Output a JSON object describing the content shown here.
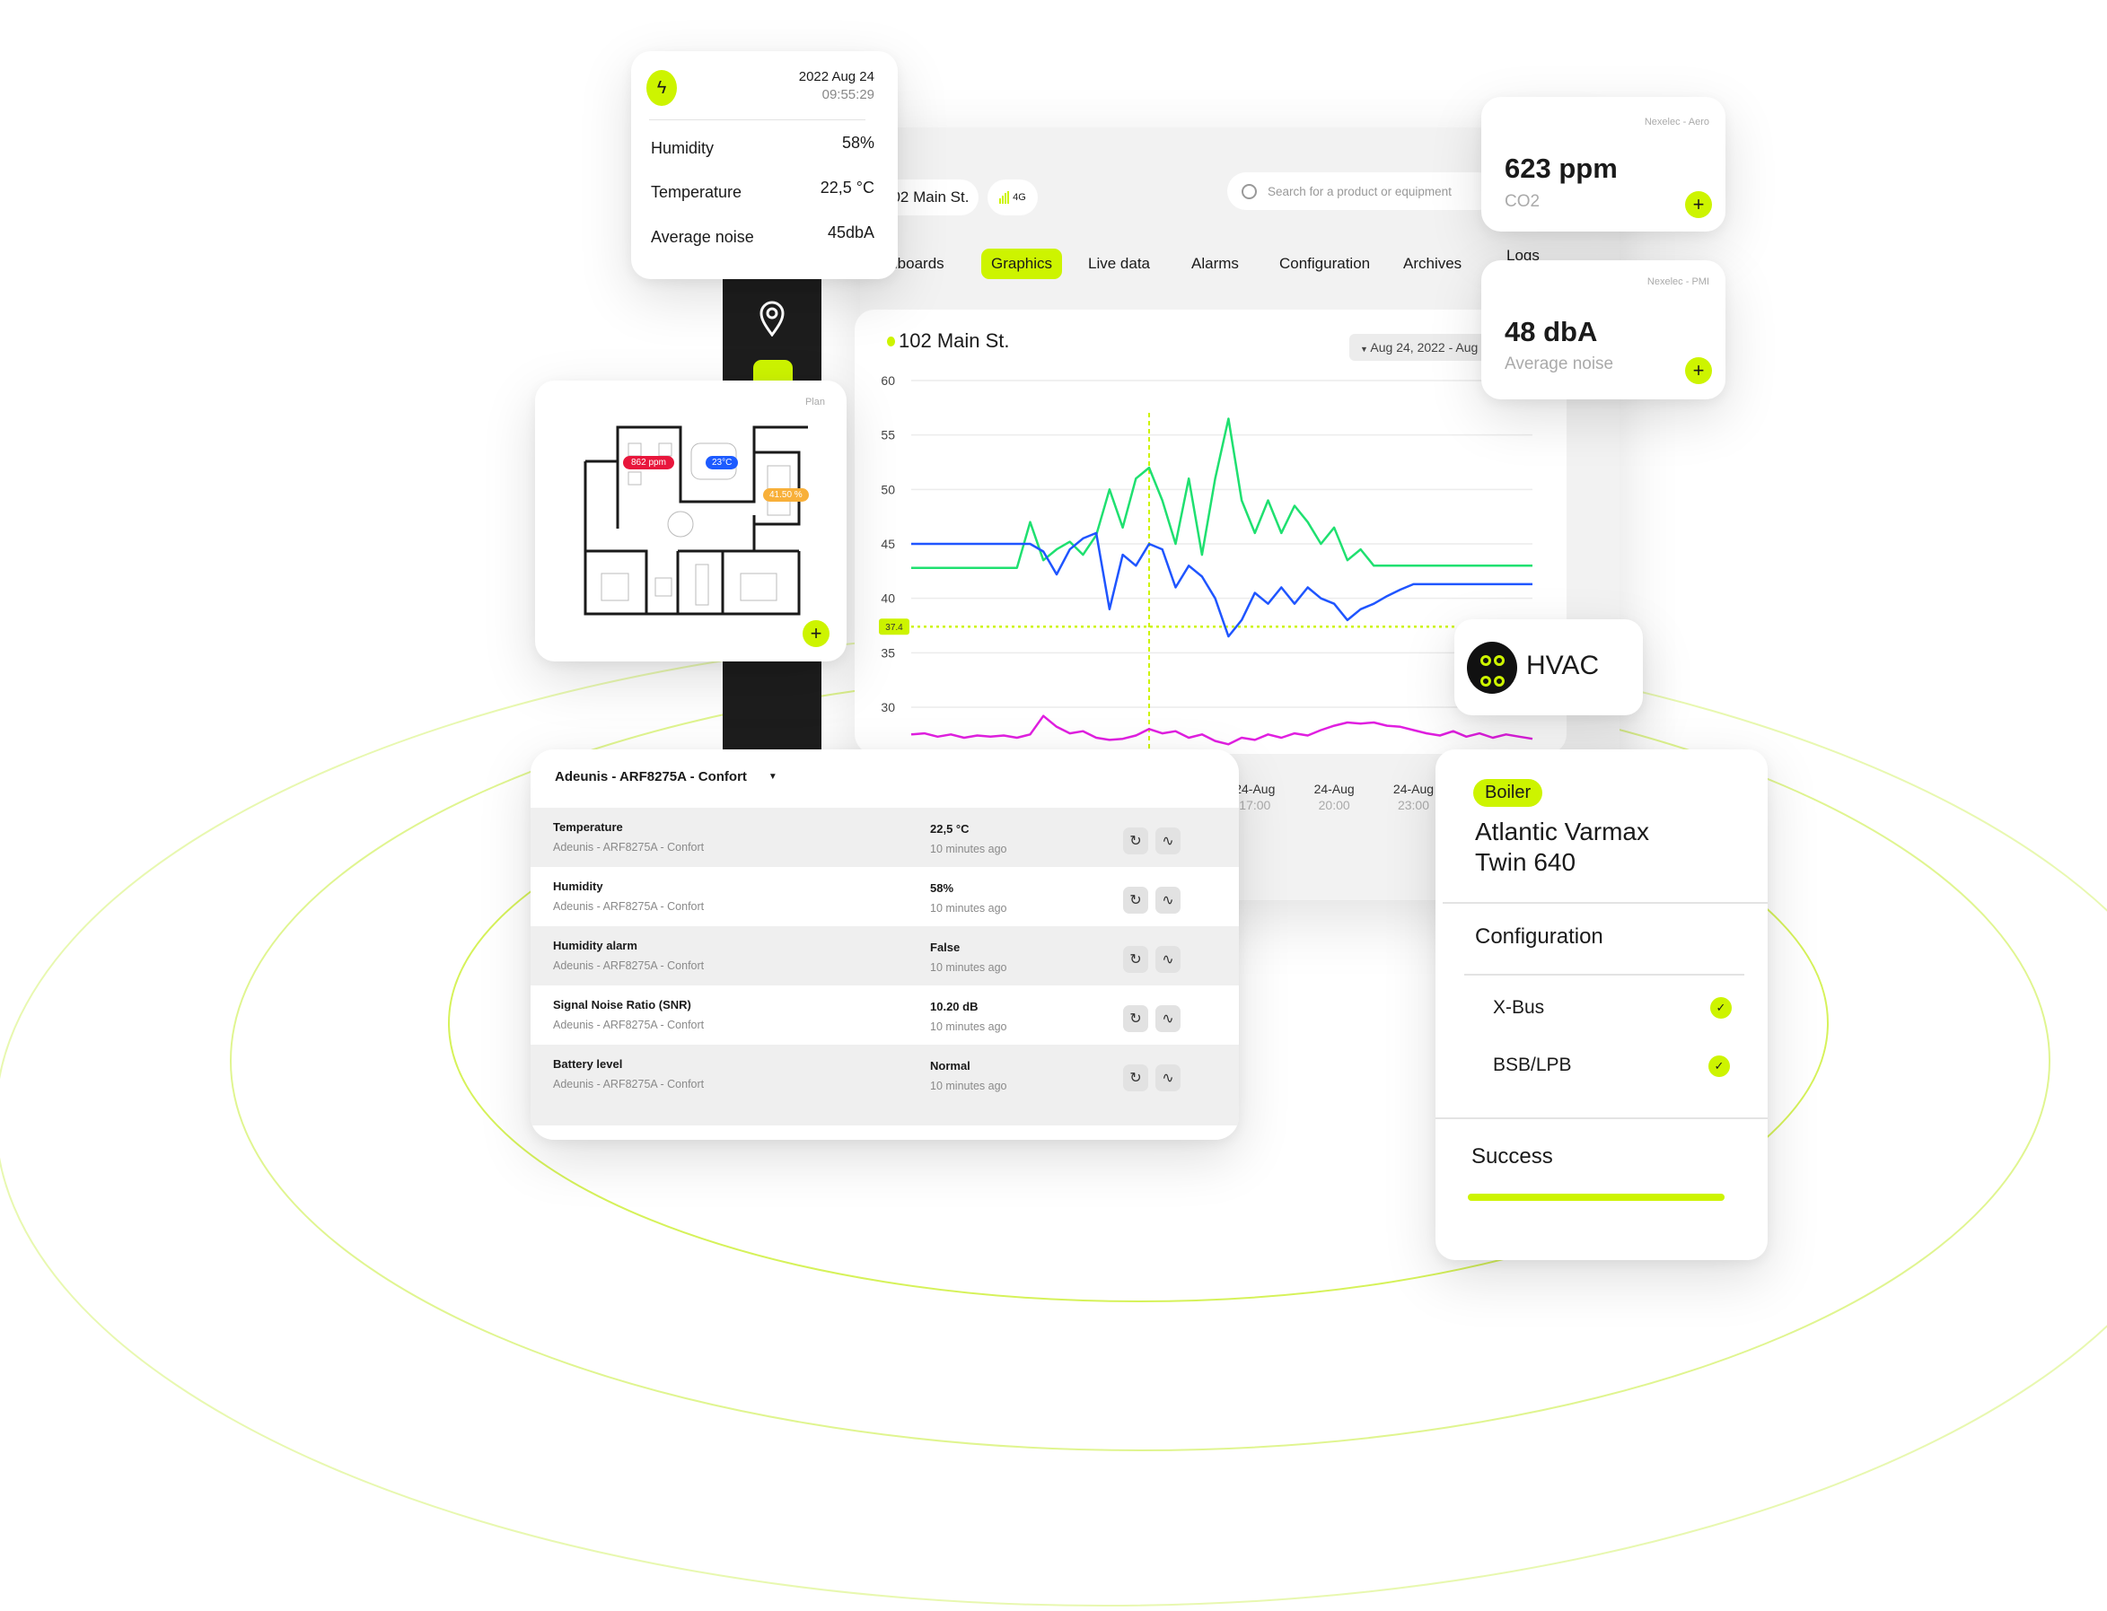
{
  "colors": {
    "accent": "#cdf400",
    "series_green": "#1fe070",
    "series_blue": "#1f55ff",
    "series_purple": "#e01fe0",
    "badge_red": "#e8163c",
    "badge_blue": "#1d5bff",
    "badge_orange": "#f8b03a"
  },
  "sensor_card": {
    "icon": "lightning-icon",
    "date": "2022 Aug 24",
    "time": "09:55:29",
    "rows": [
      {
        "label": "Humidity",
        "value": "58%"
      },
      {
        "label": "Temperature",
        "value": "22,5 °C"
      },
      {
        "label": "Average noise",
        "value": "45dbA"
      }
    ]
  },
  "header": {
    "site": "102 Main St.",
    "network": "4G",
    "search_placeholder": "Search for a product or equipment"
  },
  "tabs": [
    {
      "label": "Dashboards",
      "active": false
    },
    {
      "label": "Graphics",
      "active": true
    },
    {
      "label": "Live data",
      "active": false
    },
    {
      "label": "Alarms",
      "active": false
    },
    {
      "label": "Configuration",
      "active": false
    },
    {
      "label": "Archives",
      "active": false
    },
    {
      "label": "Logs",
      "active": false
    }
  ],
  "sidebar": {
    "items": [
      {
        "icon": "location-pin-icon"
      },
      {
        "icon": "sensor-icon",
        "active": true
      }
    ]
  },
  "chart_header": {
    "title": "102 Main St.",
    "date_range": "Aug 24, 2022 - Aug"
  },
  "chart_data": {
    "type": "line",
    "ylim": [
      30,
      60
    ],
    "yticks": [
      60,
      55,
      50,
      45,
      40,
      35,
      30
    ],
    "grid": true,
    "threshold": {
      "value": 37.4,
      "label": "37.4"
    },
    "cursor_x": "24-Aug 13:00",
    "xtick_labels": [
      {
        "x": "24-Aug 17:00",
        "date": "24-Aug",
        "time": "17:00"
      },
      {
        "x": "24-Aug 20:00",
        "date": "24-Aug",
        "time": "20:00"
      },
      {
        "x": "24-Aug 23:00",
        "date": "24-Aug",
        "time": "23:00"
      }
    ],
    "x": [
      "24-Aug 04:00",
      "24-Aug 04:30",
      "24-Aug 05:00",
      "24-Aug 05:30",
      "24-Aug 06:00",
      "24-Aug 06:30",
      "24-Aug 07:00",
      "24-Aug 07:30",
      "24-Aug 08:00",
      "24-Aug 08:30",
      "24-Aug 09:00",
      "24-Aug 09:30",
      "24-Aug 10:00",
      "24-Aug 10:30",
      "24-Aug 11:00",
      "24-Aug 11:30",
      "24-Aug 12:00",
      "24-Aug 12:30",
      "24-Aug 13:00",
      "24-Aug 13:30",
      "24-Aug 14:00",
      "24-Aug 14:30",
      "24-Aug 15:00",
      "24-Aug 15:30",
      "24-Aug 16:00",
      "24-Aug 16:30",
      "24-Aug 17:00",
      "24-Aug 17:30",
      "24-Aug 18:00",
      "24-Aug 18:30",
      "24-Aug 19:00",
      "24-Aug 19:30",
      "24-Aug 20:00",
      "24-Aug 20:30",
      "24-Aug 21:00",
      "24-Aug 21:30",
      "24-Aug 22:00",
      "24-Aug 22:30",
      "24-Aug 23:00",
      "24-Aug 23:30",
      "25-Aug 00:00",
      "25-Aug 00:30",
      "25-Aug 01:00",
      "25-Aug 01:30",
      "25-Aug 02:00",
      "25-Aug 02:30",
      "25-Aug 03:00",
      "25-Aug 03:30"
    ],
    "series": [
      {
        "color": "#1fe070",
        "values": [
          42.8,
          42.8,
          42.8,
          42.8,
          42.8,
          42.8,
          42.8,
          42.8,
          42.8,
          47,
          43.5,
          44.5,
          45.2,
          44,
          45.8,
          50,
          46.5,
          51,
          52,
          49,
          45,
          51,
          44,
          51,
          56.5,
          49,
          46,
          49,
          46,
          48.5,
          47,
          45,
          46.5,
          43.5,
          44.5,
          43,
          43,
          43,
          43,
          43,
          43,
          43,
          43,
          43,
          43,
          43,
          43,
          43
        ]
      },
      {
        "color": "#1f55ff",
        "values": [
          45,
          45,
          45,
          45,
          45,
          45,
          45,
          45,
          45,
          45,
          44.3,
          42.2,
          44.5,
          45.5,
          46,
          39,
          44,
          43,
          45,
          44.5,
          41,
          43,
          42,
          40,
          36.5,
          38,
          40.5,
          39.5,
          41,
          39.5,
          41,
          40,
          39.5,
          38,
          39,
          39.5,
          40.2,
          40.8,
          41.3,
          41.3,
          41.3,
          41.3,
          41.3,
          41.3,
          41.3,
          41.3,
          41.3,
          41.3
        ]
      },
      {
        "color": "#e01fe0",
        "values": [
          27.5,
          27.6,
          27.3,
          27.5,
          27.2,
          27.4,
          27.3,
          27.4,
          27.2,
          27.5,
          29.2,
          28.2,
          27.6,
          27.8,
          27.2,
          27,
          27.1,
          27.4,
          28,
          27.6,
          27.8,
          27.2,
          27.5,
          26.9,
          26.6,
          27.2,
          27,
          27.5,
          27.2,
          27.6,
          27.4,
          27.9,
          28.3,
          28.6,
          28.5,
          28.6,
          28.3,
          28.2,
          27.9,
          27.6,
          27.4,
          27.8,
          27.3,
          27.6,
          27.2,
          27.5,
          27.3,
          27.1
        ]
      }
    ]
  },
  "plan_card": {
    "label": "Plan",
    "badges": [
      {
        "text": "862 ppm",
        "color": "#e8163c"
      },
      {
        "text": "23°C",
        "color": "#1d5bff"
      },
      {
        "text": "41.50 %",
        "color": "#f8b03a"
      }
    ],
    "add_icon": "plus-icon"
  },
  "co2_card": {
    "source": "Nexelec - Aero",
    "value": "623 ppm",
    "label": "CO2"
  },
  "noise_card": {
    "source": "Nexelec - PMI",
    "value": "48 dbA",
    "label": "Average noise"
  },
  "hvac": {
    "icon": "hvac-grid-icon",
    "label": "HVAC"
  },
  "boiler_card": {
    "tag": "Boiler",
    "name_line1": "Atlantic Varmax",
    "name_line2": "Twin 640",
    "section": "Configuration",
    "protocols": [
      {
        "label": "X-Bus",
        "checked": true
      },
      {
        "label": "BSB/LPB",
        "checked": true
      }
    ],
    "status": "Success",
    "progress_percent": 100
  },
  "device_table": {
    "device": "Adeunis - ARF8275A - Confort",
    "rows": [
      {
        "name": "Temperature",
        "device": "Adeunis - ARF8275A - Confort",
        "value": "22,5 °C",
        "updated": "10 minutes ago"
      },
      {
        "name": "Humidity",
        "device": "Adeunis - ARF8275A - Confort",
        "value": "58%",
        "updated": "10 minutes ago"
      },
      {
        "name": "Humidity alarm",
        "device": "Adeunis - ARF8275A - Confort",
        "value": "False",
        "updated": "10 minutes ago"
      },
      {
        "name": "Signal Noise Ratio (SNR)",
        "device": "Adeunis - ARF8275A - Confort",
        "value": "10.20 dB",
        "updated": "10 minutes ago"
      },
      {
        "name": "Battery level",
        "device": "Adeunis - ARF8275A - Confort",
        "value": "Normal",
        "updated": "10 minutes ago"
      }
    ]
  }
}
